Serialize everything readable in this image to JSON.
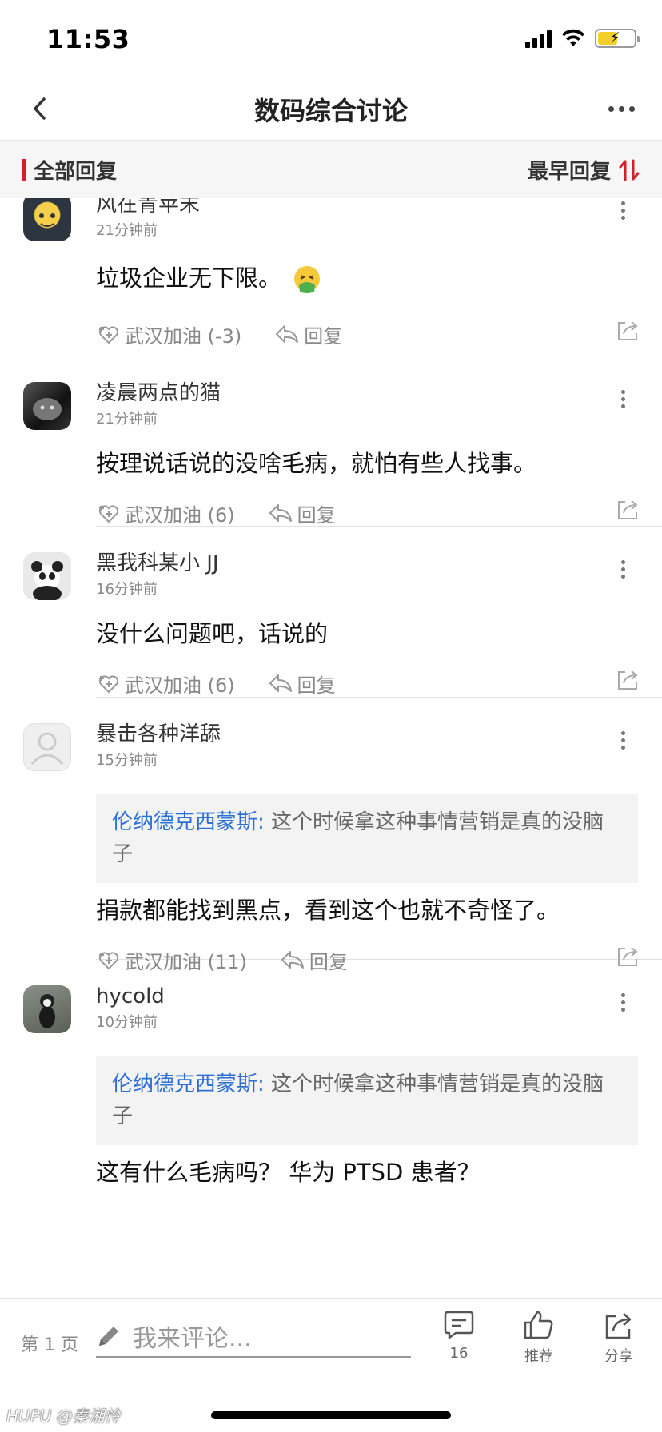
{
  "status_bar": {
    "time": "11:53"
  },
  "nav": {
    "title": "数码综合讨论"
  },
  "filter": {
    "all_replies": "全部回复",
    "sort_label": "最早回复"
  },
  "comments": [
    {
      "username": "风在青苹末",
      "time": "21分钟前",
      "text": "垃圾企业无下限。",
      "like_label": "武汉加油 (-3)",
      "reply_label": "回复",
      "emoji": "nauseated-face"
    },
    {
      "username": "凌晨两点的猫",
      "time": "21分钟前",
      "text": "按理说话说的没啥毛病，就怕有些人找事。",
      "like_label": "武汉加油 (6)",
      "reply_label": "回复"
    },
    {
      "username": "黑我科某小 JJ",
      "time": "16分钟前",
      "text": "没什么问题吧，话说的",
      "like_label": "武汉加油 (6)",
      "reply_label": "回复"
    },
    {
      "username": "暴击各种洋舔",
      "time": "15分钟前",
      "quote_author": "伦纳德克西蒙斯:",
      "quote_text": " 这个时候拿这种事情营销是真的没脑子",
      "text": "捐款都能找到黑点，看到这个也就不奇怪了。",
      "like_label": "武汉加油 (11)",
      "reply_label": "回复"
    },
    {
      "username": "hycold",
      "time": "10分钟前",
      "quote_author": "伦纳德克西蒙斯:",
      "quote_text": " 这个时候拿这种事情营销是真的没脑子",
      "text": "这有什么毛病吗？  华为 PTSD 患者？"
    }
  ],
  "bottom_bar": {
    "page": "第 1 页",
    "input_placeholder": "我来评论...",
    "comment_count": "16",
    "recommend_label": "推荐",
    "share_label": "分享"
  },
  "watermark": "HUPU @秦湘怜"
}
